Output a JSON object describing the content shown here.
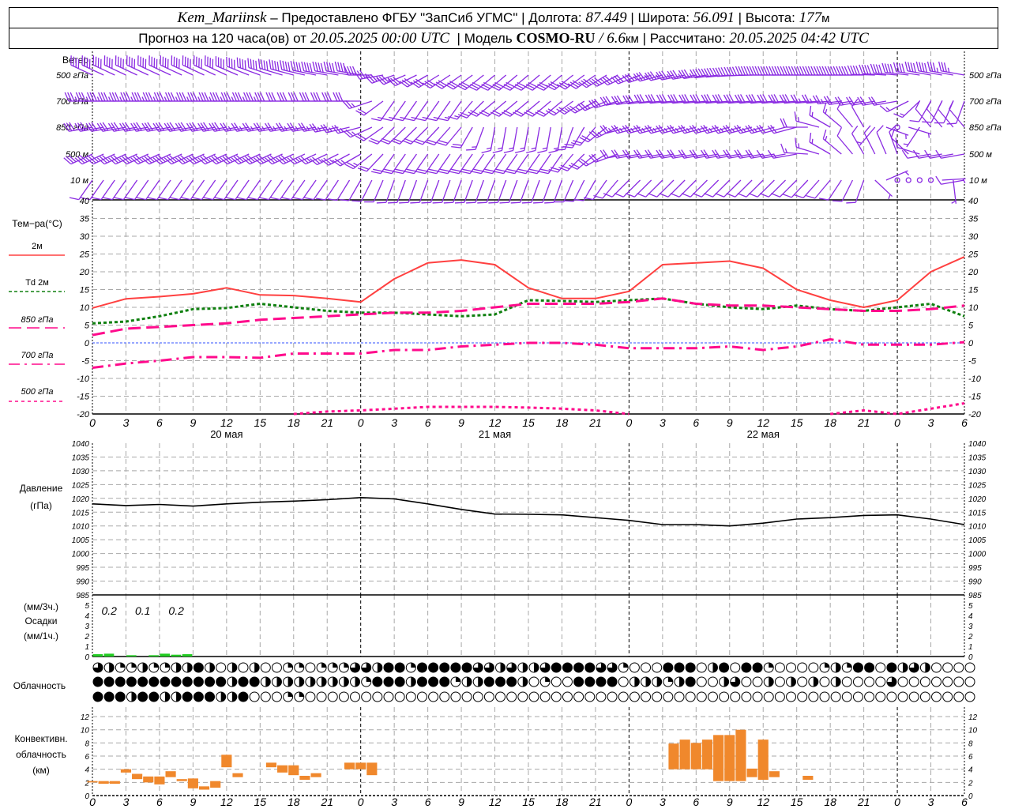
{
  "header": {
    "station": "Kem_Mariinsk",
    "dash": "–",
    "provider": "Предоставлено ФГБУ \"ЗапСиб УГМС\"",
    "sep": "|",
    "lon_label": "Долгота:",
    "lon": "87.449",
    "lat_label": "Широта:",
    "lat": "56.091",
    "alt_label": "Высота:",
    "alt": "177",
    "alt_unit": "м",
    "forecast_prefix": "Прогноз на 120 часа(ов) от",
    "forecast_time": "20.05.2025 00:00 UTC",
    "model_label": "Модель",
    "model": "COSMO-RU",
    "model_sep": "/",
    "resolution": "6.6",
    "res_unit": "км",
    "computed_label": "Рассчитано:",
    "computed_time": "20.05.2025 04:42 UTC"
  },
  "x_axis": {
    "hour_labels": [
      "0",
      "3",
      "6",
      "9",
      "12",
      "15",
      "18",
      "21",
      "0",
      "3",
      "6",
      "9",
      "12",
      "15",
      "18",
      "21",
      "0",
      "3",
      "6",
      "9",
      "12",
      "15",
      "18",
      "21",
      "0",
      "3",
      "6"
    ],
    "date_labels": [
      "20 мая",
      "21 мая",
      "22 мая"
    ]
  },
  "colors": {
    "wind": "#8a2be2",
    "t2m": "#ff4040",
    "td2m": "#108010",
    "upper": "#ff0a8c",
    "zero_line": "#3050ff",
    "pressure": "#000000",
    "precip": "#22cc22",
    "convective": "#f0882c",
    "grid": "#a8a8a8"
  },
  "labels": {
    "wind_title": "Ветер",
    "wind_levels_left": [
      "500 гПа",
      "700 гПа",
      "850 гПа",
      "500 м",
      "10  м"
    ],
    "wind_levels_right": [
      "500 гПа",
      "700 гПа",
      "850 гПа",
      "500 м",
      "10  м"
    ],
    "temp_title": "Тем−ра(°C)",
    "legend": [
      "2м",
      "Td  2м",
      "850 гПа",
      "700 гПа",
      "500 гПа"
    ],
    "pressure_title": "Давление",
    "pressure_unit": "(гПа)",
    "precip_unit3": "(мм/3ч.)",
    "precip_title": "Осадки",
    "precip_unit1": "(мм/1ч.)",
    "cloud_title": "Облачность",
    "conv_title1": "Конвективн.",
    "conv_title2": "облачность",
    "conv_unit": "(км)"
  },
  "chart_data": [
    {
      "type": "wind_barbs",
      "name": "Ветер",
      "hours": [
        0,
        3,
        6,
        9,
        12,
        15,
        18,
        21,
        24,
        27,
        30,
        33,
        36,
        39,
        42,
        45,
        48,
        51,
        54,
        57,
        60,
        63,
        66,
        69,
        72,
        75,
        78
      ],
      "levels": [
        {
          "name": "500 гПа",
          "dir": [
            295,
            295,
            295,
            295,
            295,
            290,
            285,
            280,
            280,
            250,
            240,
            235,
            230,
            230,
            230,
            235,
            245,
            255,
            260,
            265,
            270,
            270,
            270,
            270,
            275,
            280,
            280
          ],
          "speed": [
            20,
            20,
            20,
            20,
            20,
            20,
            20,
            20,
            20,
            17,
            15,
            15,
            15,
            15,
            15,
            15,
            15,
            17,
            17,
            20,
            20,
            20,
            20,
            20,
            20,
            20,
            17
          ]
        },
        {
          "name": "700 гПа",
          "dir": [
            270,
            270,
            270,
            270,
            270,
            270,
            270,
            270,
            270,
            215,
            215,
            215,
            230,
            230,
            230,
            240,
            260,
            265,
            265,
            265,
            265,
            265,
            265,
            260,
            260,
            210,
            200
          ],
          "speed": [
            17,
            17,
            17,
            17,
            17,
            17,
            15,
            15,
            15,
            7.5,
            7.5,
            7.5,
            10,
            10,
            10,
            12.5,
            15,
            15,
            15,
            15,
            15,
            15,
            12.5,
            10,
            10,
            5,
            5
          ]
        },
        {
          "name": "850 гПа",
          "dir": [
            260,
            260,
            260,
            260,
            260,
            260,
            260,
            260,
            255,
            225,
            225,
            220,
            190,
            190,
            190,
            220,
            255,
            255,
            255,
            255,
            255,
            255,
            300,
            330,
            0,
            320,
            320
          ],
          "speed": [
            15,
            15,
            15,
            15,
            15,
            12.5,
            12.5,
            12.5,
            12.5,
            10,
            10,
            10,
            7.5,
            7.5,
            7.5,
            10,
            12.5,
            12.5,
            12.5,
            12.5,
            12.5,
            10,
            7.5,
            5,
            0,
            5,
            5
          ]
        },
        {
          "name": "500 м",
          "dir": [
            245,
            245,
            245,
            245,
            245,
            245,
            245,
            245,
            240,
            215,
            215,
            215,
            215,
            215,
            215,
            230,
            260,
            260,
            260,
            260,
            260,
            260,
            300,
            330,
            340,
            260,
            260
          ],
          "speed": [
            15,
            15,
            15,
            15,
            15,
            15,
            15,
            12.5,
            12.5,
            10,
            10,
            10,
            10,
            10,
            10,
            10,
            10,
            10,
            10,
            10,
            10,
            7.5,
            7.5,
            5,
            5,
            5,
            5
          ]
        },
        {
          "name": "10  м",
          "dir": [
            215,
            215,
            215,
            215,
            215,
            215,
            215,
            215,
            210,
            200,
            200,
            200,
            200,
            200,
            200,
            210,
            225,
            225,
            225,
            225,
            225,
            225,
            220,
            200,
            0,
            0,
            260
          ],
          "speed": [
            5,
            5,
            5,
            5,
            5,
            5,
            5,
            5,
            5,
            5,
            5,
            5,
            5,
            5,
            5,
            5,
            5,
            5,
            5,
            5,
            5,
            5,
            5,
            5,
            0,
            0,
            5
          ]
        }
      ]
    },
    {
      "type": "line",
      "name": "Тем−ра(°C)",
      "ylim": [
        -20,
        40
      ],
      "yticks": [
        "40",
        "35",
        "30",
        "25",
        "20",
        "15",
        "10",
        "5",
        "0",
        "-5",
        "-10",
        "-15",
        "-20"
      ],
      "grid": true,
      "x_hours": [
        0,
        3,
        6,
        9,
        12,
        15,
        18,
        21,
        24,
        27,
        30,
        33,
        36,
        39,
        42,
        45,
        48,
        51,
        54,
        57,
        60,
        63,
        66,
        69,
        72,
        75,
        78
      ],
      "series": [
        {
          "name": "2м",
          "style": "solid",
          "values": [
            9.8,
            12.4,
            13,
            13.8,
            15.5,
            13.5,
            13.3,
            12.5,
            11.5,
            18,
            22.5,
            23.3,
            22,
            15.5,
            12.5,
            12.5,
            14.5,
            22,
            22.5,
            23,
            21,
            15,
            12,
            10,
            12,
            20,
            24.2
          ]
        },
        {
          "name": "Td  2м",
          "style": "dotted",
          "values": [
            5.5,
            6,
            7.5,
            9.5,
            9.8,
            11,
            10,
            9,
            8.5,
            8.5,
            8,
            7.5,
            8,
            12,
            11.8,
            11.5,
            12,
            12.5,
            11,
            10,
            9.5,
            10.5,
            9.5,
            9,
            10,
            11,
            7.5
          ]
        },
        {
          "name": "850 гПа",
          "style": "long-dash",
          "values": [
            2.2,
            4,
            4.5,
            5,
            5.5,
            6.5,
            7,
            7.5,
            8,
            8.5,
            8.5,
            9,
            10,
            11,
            11,
            11,
            11.5,
            12.5,
            11,
            10.5,
            10.5,
            10,
            9.5,
            9,
            9,
            9.5,
            10.5
          ]
        },
        {
          "name": "700 гПа",
          "style": "dash-dot",
          "values": [
            -7,
            -5.8,
            -5,
            -4,
            -4,
            -4.2,
            -3,
            -3,
            -3,
            -2,
            -2,
            -1,
            -0.5,
            0,
            0,
            -0.5,
            -1.5,
            -1.5,
            -1.5,
            -1,
            -2,
            -1,
            1,
            -0.5,
            -0.5,
            -0.5,
            0.2
          ]
        },
        {
          "name": "500 гПа",
          "style": "dotted-fine",
          "values": [
            null,
            null,
            null,
            null,
            null,
            null,
            -20,
            -19.3,
            -19,
            -18.5,
            -18,
            -18,
            -18,
            -18.2,
            -18.5,
            -19,
            -20,
            null,
            null,
            null,
            null,
            null,
            -20,
            -19,
            -20,
            -18.5,
            -17
          ]
        }
      ]
    },
    {
      "type": "line",
      "name": "Давление",
      "unit": "(гПа)",
      "ylim": [
        985,
        1040
      ],
      "yticks": [
        "1040",
        "1035",
        "1030",
        "1025",
        "1020",
        "1015",
        "1010",
        "1005",
        "1000",
        "995",
        "990",
        "985"
      ],
      "x_hours": [
        0,
        3,
        6,
        9,
        12,
        15,
        18,
        21,
        24,
        27,
        30,
        33,
        36,
        39,
        42,
        45,
        48,
        51,
        54,
        57,
        60,
        63,
        66,
        69,
        72,
        75,
        78
      ],
      "values": [
        1018,
        1017.4,
        1017.8,
        1017.2,
        1018,
        1018.6,
        1019,
        1019.5,
        1020.3,
        1019.8,
        1018,
        1016,
        1014.3,
        1014.2,
        1014,
        1013,
        1012,
        1010.5,
        1010.5,
        1010,
        1011,
        1012.5,
        1013,
        1013.8,
        1014,
        1012.5,
        1010.5
      ]
    },
    {
      "type": "bar",
      "name": "Осадки",
      "ylim": [
        0,
        5
      ],
      "yticks": [
        "5",
        "4",
        "3",
        "2",
        "1",
        "0"
      ],
      "hourly": [
        {
          "hour": 0,
          "value": 0.15
        },
        {
          "hour": 1,
          "value": 0.2
        },
        {
          "hour": 3,
          "value": 0.05
        },
        {
          "hour": 5,
          "value": 0.05
        },
        {
          "hour": 6,
          "value": 0.2
        },
        {
          "hour": 7,
          "value": 0.1
        },
        {
          "hour": 8,
          "value": 0.15
        }
      ],
      "three_hour_totals": [
        {
          "hour": 0,
          "label": "0.2"
        },
        {
          "hour": 3,
          "label": "0.1"
        },
        {
          "hour": 6,
          "label": "0.2"
        }
      ]
    },
    {
      "type": "symbols",
      "name": "Облачность",
      "encoding": "octas/2: 0 clear, 1 quarter, 2 half, 3 three-quarter, 4 overcast",
      "rows": [
        [
          3,
          2,
          1,
          1,
          2,
          1,
          1,
          2,
          2,
          4,
          2,
          0,
          2,
          0,
          2,
          0,
          0,
          1,
          1,
          0,
          1,
          1,
          1,
          3,
          3,
          2,
          4,
          4,
          1,
          4,
          4,
          4,
          4,
          4,
          3,
          3,
          2,
          3,
          2,
          2,
          3,
          4,
          4,
          4,
          4,
          3,
          3,
          1,
          0,
          0,
          0,
          4,
          4,
          4,
          0,
          2,
          4,
          0,
          4,
          4,
          1,
          0,
          0,
          0,
          0,
          1,
          2,
          1,
          4,
          4,
          0,
          4,
          2,
          3,
          2,
          0,
          0,
          0,
          0
        ],
        [
          4,
          4,
          4,
          4,
          4,
          4,
          4,
          4,
          4,
          4,
          4,
          4,
          2,
          4,
          4,
          2,
          2,
          2,
          2,
          2,
          2,
          2,
          2,
          2,
          1,
          4,
          4,
          4,
          2,
          4,
          4,
          4,
          1,
          2,
          2,
          4,
          4,
          4,
          2,
          0,
          1,
          0,
          0,
          4,
          4,
          4,
          4,
          0,
          2,
          2,
          2,
          1,
          2,
          4,
          0,
          0,
          2,
          3,
          0,
          0,
          2,
          0,
          2,
          0,
          2,
          0,
          2,
          0,
          0,
          0,
          0,
          3,
          0,
          0,
          0,
          0,
          0,
          0,
          0
        ],
        [
          4,
          4,
          4,
          2,
          4,
          4,
          2,
          2,
          4,
          4,
          4,
          2,
          2,
          4,
          0,
          0,
          0,
          1,
          1,
          0,
          0,
          0,
          0,
          0,
          0,
          0,
          0,
          0,
          0,
          0,
          0,
          0,
          0,
          0,
          0,
          0,
          0,
          0,
          0,
          0,
          0,
          0,
          0,
          0,
          0,
          0,
          0,
          0,
          0,
          0,
          0,
          0,
          0,
          0,
          0,
          0,
          0,
          0,
          0,
          0,
          0,
          0,
          0,
          0,
          0,
          0,
          0,
          0,
          0,
          0,
          0,
          0,
          0,
          0,
          0,
          0,
          0,
          0,
          0
        ]
      ]
    },
    {
      "type": "range_bar",
      "name": "Конвективн. облачность",
      "unit": "(км)",
      "ylim": [
        0,
        13
      ],
      "yticks": [
        "12",
        "10",
        "8",
        "6",
        "4",
        "2",
        "0"
      ],
      "bars": [
        {
          "hour": 0,
          "base": 2.0,
          "top": 2.2
        },
        {
          "hour": 1,
          "base": 1.8,
          "top": 2.2
        },
        {
          "hour": 2,
          "base": 1.8,
          "top": 2.2
        },
        {
          "hour": 3,
          "base": 3.5,
          "top": 4.0
        },
        {
          "hour": 4,
          "base": 2.5,
          "top": 3.3
        },
        {
          "hour": 5,
          "base": 2.0,
          "top": 2.9
        },
        {
          "hour": 6,
          "base": 1.7,
          "top": 2.9
        },
        {
          "hour": 7,
          "base": 2.8,
          "top": 3.7
        },
        {
          "hour": 8,
          "base": 2.2,
          "top": 2.5
        },
        {
          "hour": 9,
          "base": 1.1,
          "top": 2.6
        },
        {
          "hour": 10,
          "base": 0.9,
          "top": 1.4
        },
        {
          "hour": 11,
          "base": 1.2,
          "top": 2.2
        },
        {
          "hour": 12,
          "base": 4.3,
          "top": 6.2
        },
        {
          "hour": 13,
          "base": 2.8,
          "top": 3.4
        },
        {
          "hour": 16,
          "base": 4.3,
          "top": 5.0
        },
        {
          "hour": 17,
          "base": 3.5,
          "top": 4.6
        },
        {
          "hour": 18,
          "base": 3.1,
          "top": 4.6
        },
        {
          "hour": 19,
          "base": 2.4,
          "top": 3.0
        },
        {
          "hour": 20,
          "base": 2.8,
          "top": 3.4
        },
        {
          "hour": 23,
          "base": 4.0,
          "top": 5.0
        },
        {
          "hour": 24,
          "base": 4.0,
          "top": 5.0
        },
        {
          "hour": 25,
          "base": 3.1,
          "top": 5.0
        },
        {
          "hour": 52,
          "base": 4.0,
          "top": 7.9
        },
        {
          "hour": 53,
          "base": 4.0,
          "top": 8.5
        },
        {
          "hour": 54,
          "base": 4.0,
          "top": 8.0
        },
        {
          "hour": 55,
          "base": 4.0,
          "top": 8.5
        },
        {
          "hour": 56,
          "base": 2.2,
          "top": 9.2
        },
        {
          "hour": 57,
          "base": 2.2,
          "top": 9.2
        },
        {
          "hour": 58,
          "base": 2.2,
          "top": 10.0
        },
        {
          "hour": 59,
          "base": 2.8,
          "top": 4.1
        },
        {
          "hour": 60,
          "base": 2.4,
          "top": 8.5
        },
        {
          "hour": 61,
          "base": 2.8,
          "top": 3.7
        },
        {
          "hour": 64,
          "base": 2.4,
          "top": 3.0
        }
      ]
    }
  ]
}
